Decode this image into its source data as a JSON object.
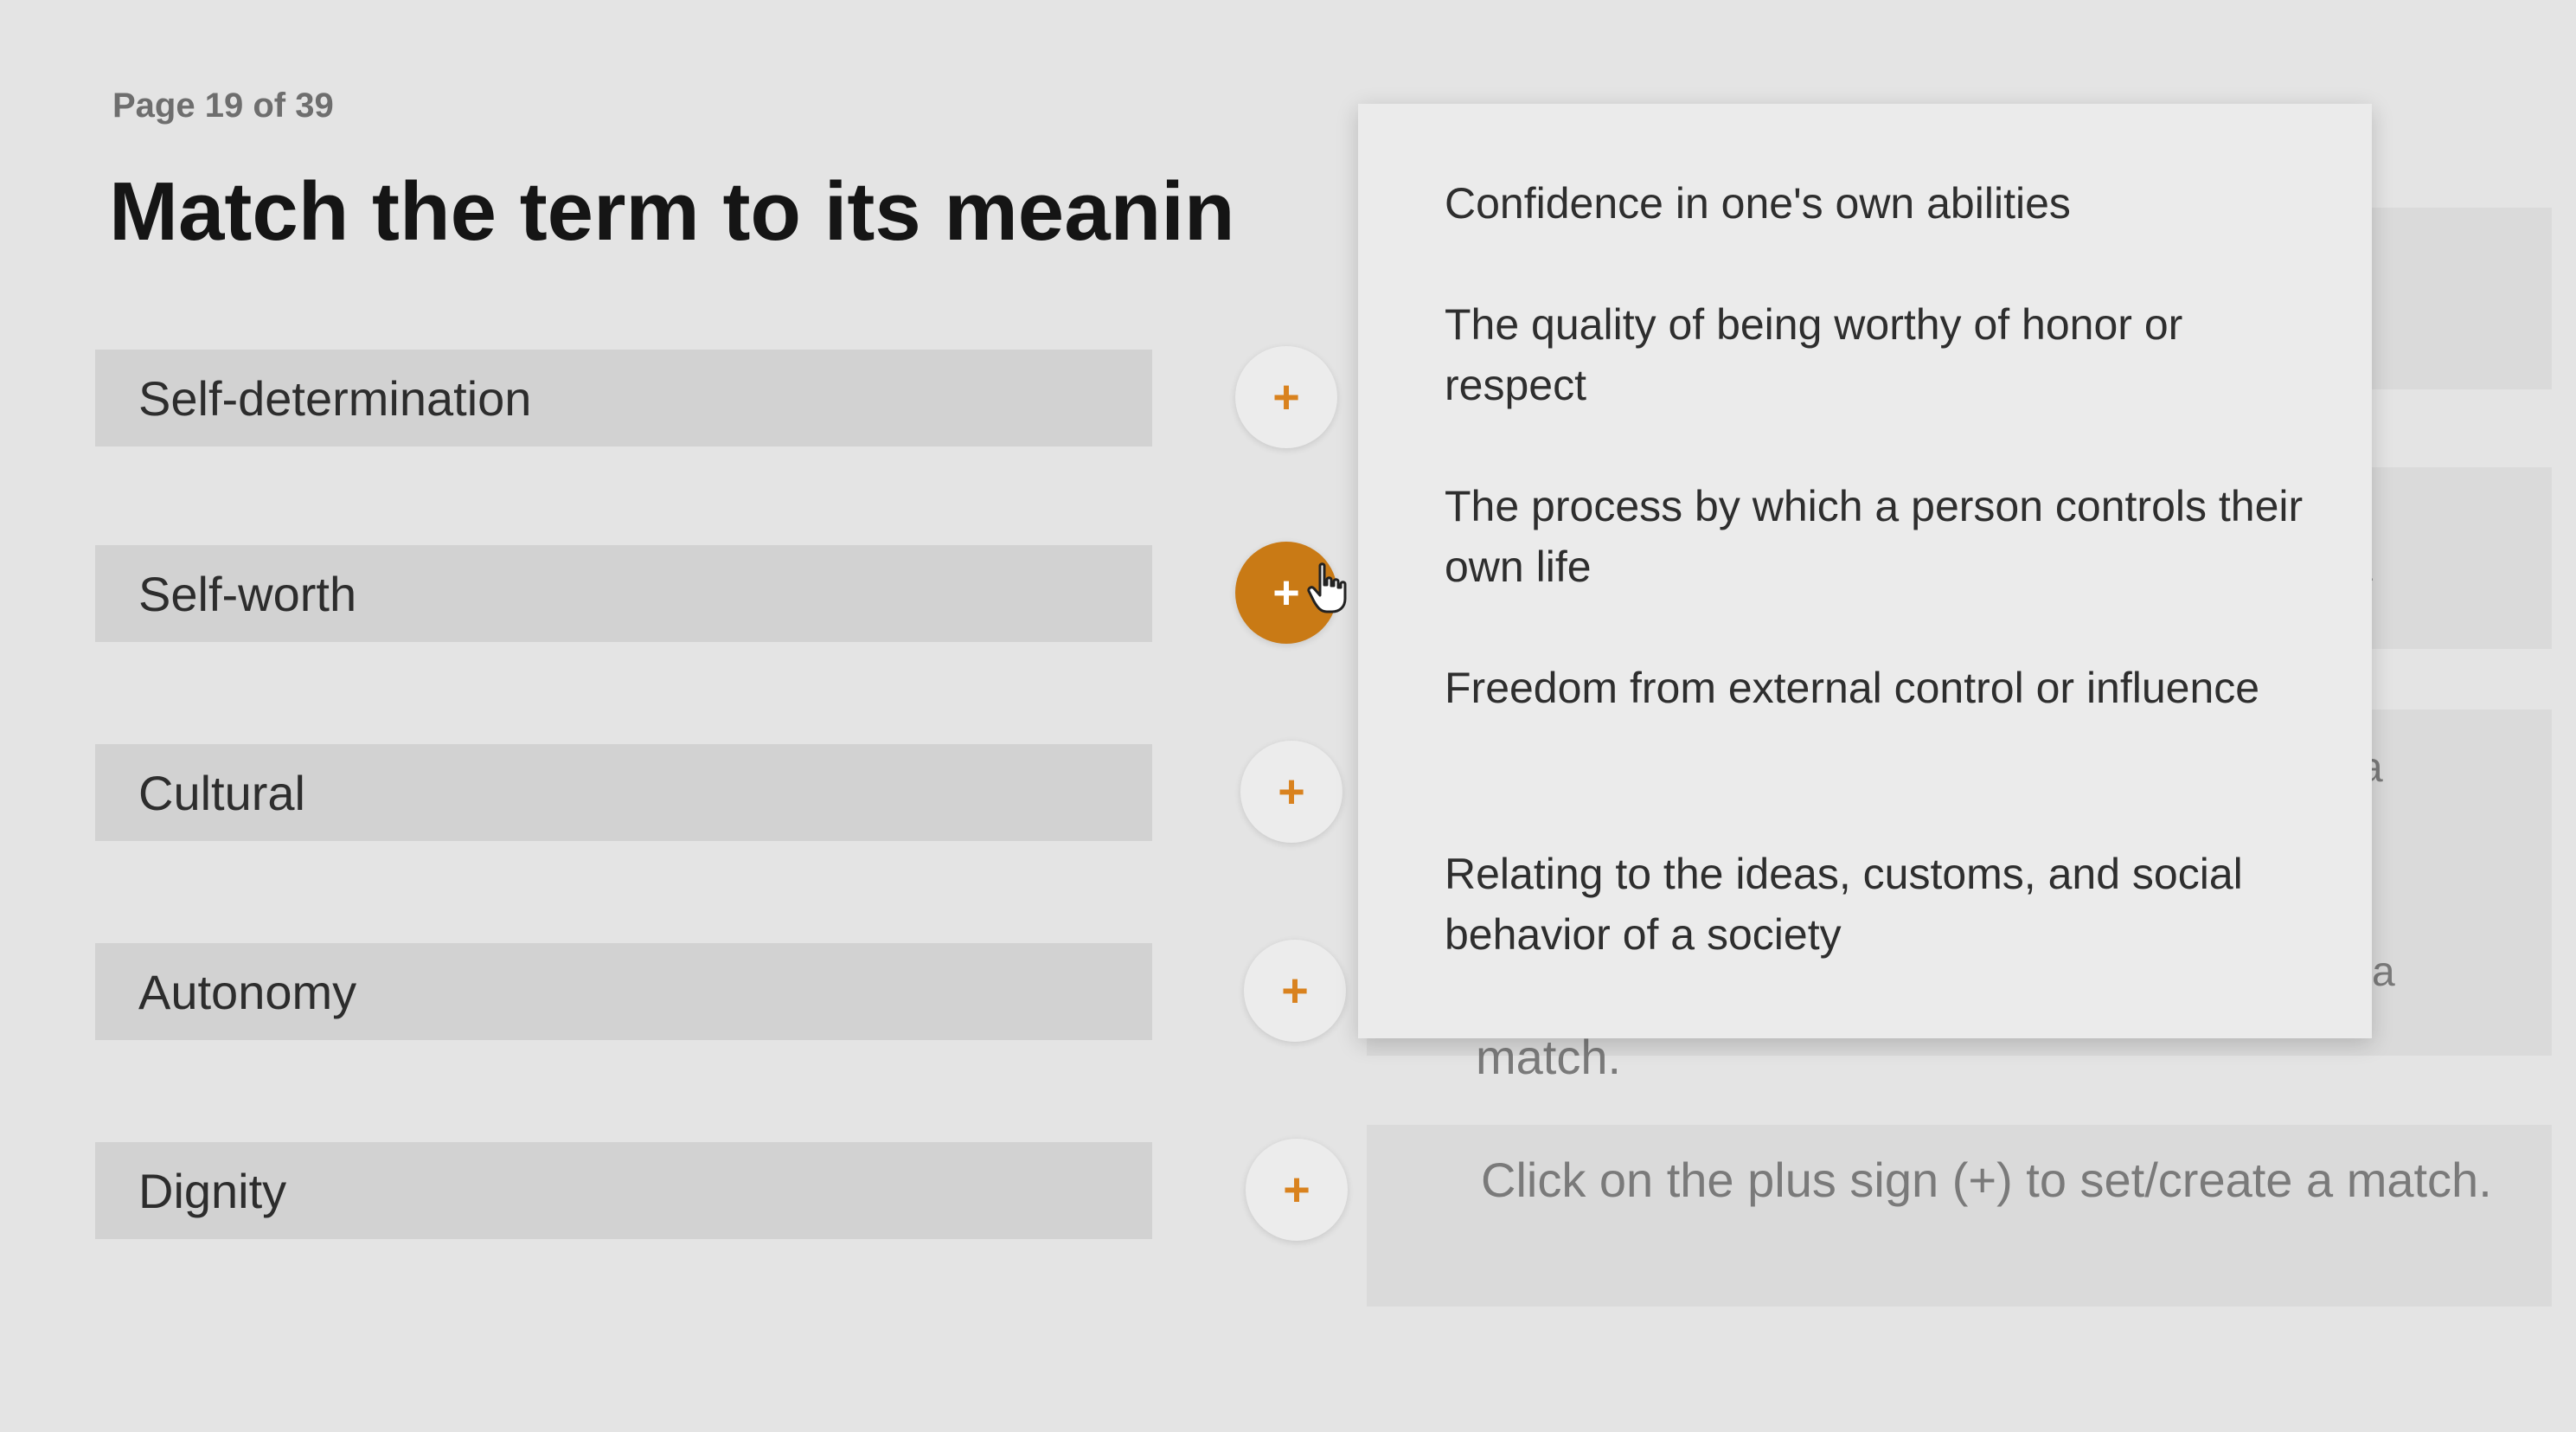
{
  "page_counter": "Page 19 of 39",
  "title": "Match the term to its meanin",
  "terms": [
    {
      "label": "Self-determination"
    },
    {
      "label": "Self-worth"
    },
    {
      "label": "Cultural"
    },
    {
      "label": "Autonomy"
    },
    {
      "label": "Dignity"
    }
  ],
  "plus_symbol": "+",
  "dropdown": {
    "options": [
      "Confidence in one's own abilities",
      "The quality of being worthy of honor or respect",
      "The process by which a person controls their own life",
      "Freedom from external control or influence",
      "Relating to the ideas, customs, and social behavior of a society"
    ]
  },
  "side_letters": [
    "a",
    "a",
    "a",
    "a"
  ],
  "instruction_partial": "match.",
  "instruction": "Click on the plus sign (+) to set/create a match.",
  "colors": {
    "accent": "#c97a15",
    "plus": "#d9821e"
  },
  "icons": {
    "cursor": "hand-pointer-icon"
  }
}
